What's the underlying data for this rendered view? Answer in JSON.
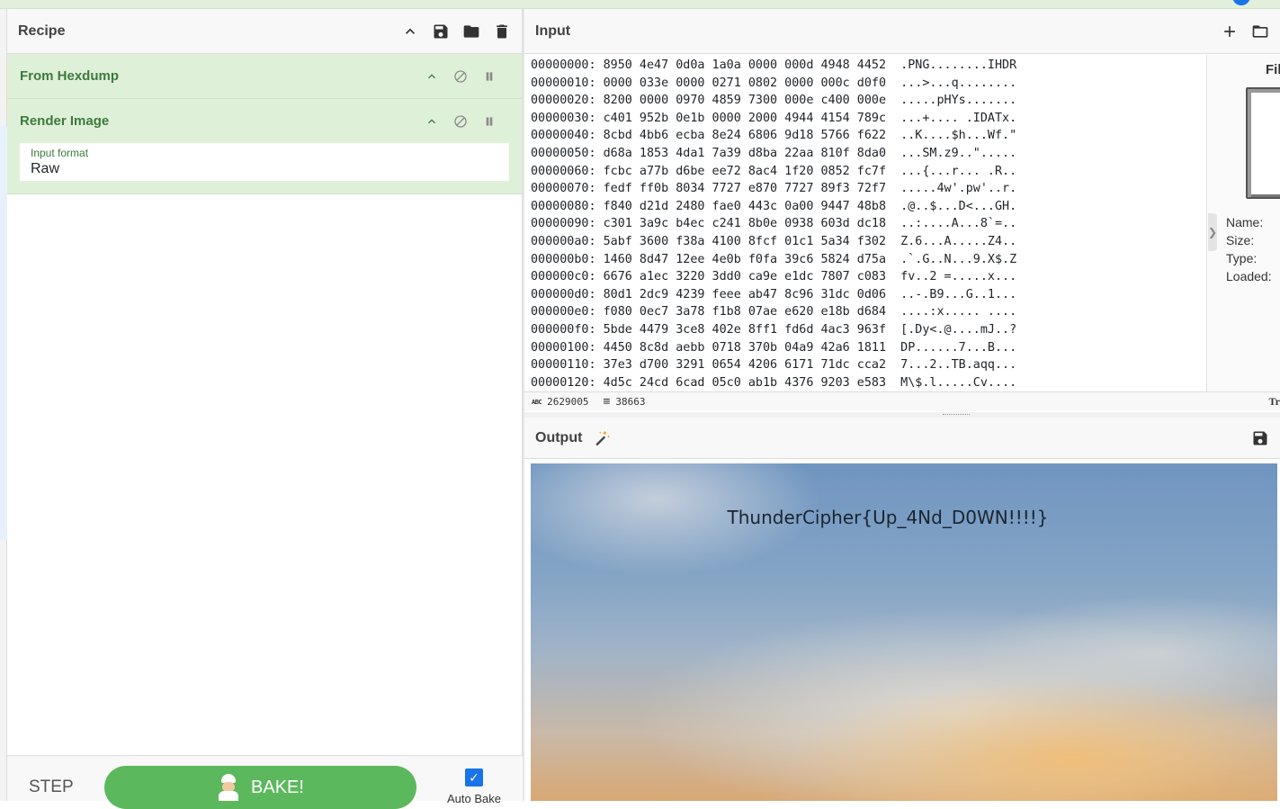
{
  "recipe": {
    "title": "Recipe",
    "operations": [
      {
        "name": "From Hexdump"
      },
      {
        "name": "Render Image",
        "field_label": "Input format",
        "field_value": "Raw"
      }
    ],
    "step_label": "STEP",
    "bake_label": "BAKE!",
    "auto_bake_label": "Auto Bake",
    "auto_bake_checked": true
  },
  "input": {
    "title": "Input",
    "hex_lines": [
      "00000000: 8950 4e47 0d0a 1a0a 0000 000d 4948 4452  .PNG........IHDR",
      "00000010: 0000 033e 0000 0271 0802 0000 000c d0f0  ...>...q........",
      "00000020: 8200 0000 0970 4859 7300 000e c400 000e  .....pHYs.......",
      "00000030: c401 952b 0e1b 0000 2000 4944 4154 789c  ...+.... .IDATx.",
      "00000040: 8cbd 4bb6 ecba 8e24 6806 9d18 5766 f622  ..K....$h...Wf.\"",
      "00000050: d68a 1853 4da1 7a39 d8ba 22aa 810f 8da0  ...SM.z9..\".....",
      "00000060: fcbc a77b d6be ee72 8ac4 1f20 0852 fc7f  ...{...r... .R..",
      "00000070: fedf ff0b 8034 7727 e870 7727 89f3 72f7  .....4w'.pw'..r.",
      "00000080: f840 d21d 2480 fae0 443c 0a00 9447 48b8  .@..$...D<...GH.",
      "00000090: c301 3a9c b4ec c241 8b0e 0938 603d dc18  ..:....A...8`=..",
      "000000a0: 5abf 3600 f38a 4100 8fcf 01c1 5a34 f302  Z.6...A.....Z4..",
      "000000b0: 1460 8d47 12ee 4e0b f0fa 39c6 5824 d75a  .`.G..N...9.X$.Z",
      "000000c0: 6676 a1ec 3220 3dd0 ca9e e1dc 7807 c083  fv..2 =.....x...",
      "000000d0: 80d1 2dc9 4239 feee ab47 8c96 31dc 0d06  ..-.B9...G..1...",
      "000000e0: f080 0ec7 3a78 f1b8 07ae e620 e18b d684  ....:x..... ....",
      "000000f0: 5bde 4479 3ce8 402e 8ff1 fd6d 4ac3 963f  [.Dy<.@....mJ..?",
      "00000100: 4450 8c8d aebb 0718 370b 04a9 42a6 1811  DP......7...B...",
      "00000110: 37e3 d700 3291 0654 4206 6171 71dc cca2  7...2..TB.aqq...",
      "00000120: 4d5c 24cd 6cad 05c0 ab1b 4376 9203 e583  M\\$.l.....Cv...."
    ],
    "file_title": "Fil",
    "file_meta": [
      "Name:",
      "Size:",
      "Type:",
      "Loaded:"
    ],
    "status": {
      "abc_icon": "ABC",
      "length": "2629005",
      "lines": "38663",
      "tr_icon": "Tr"
    }
  },
  "output": {
    "title": "Output",
    "image_text": "ThunderCipher{Up_4Nd_D0WN!!!!}"
  },
  "icons": {
    "collapse": "chevron-up-icon",
    "save": "save-icon",
    "open": "folder-icon",
    "clear": "trash-icon",
    "disable": "disable-icon",
    "pause": "pause-icon",
    "add": "plus-icon",
    "wand": "magic-wand-icon"
  },
  "colors": {
    "op_bg": "#dff0d8",
    "op_text": "#3c7a3c",
    "bake": "#5cb85c",
    "accent": "#1a73e8"
  }
}
